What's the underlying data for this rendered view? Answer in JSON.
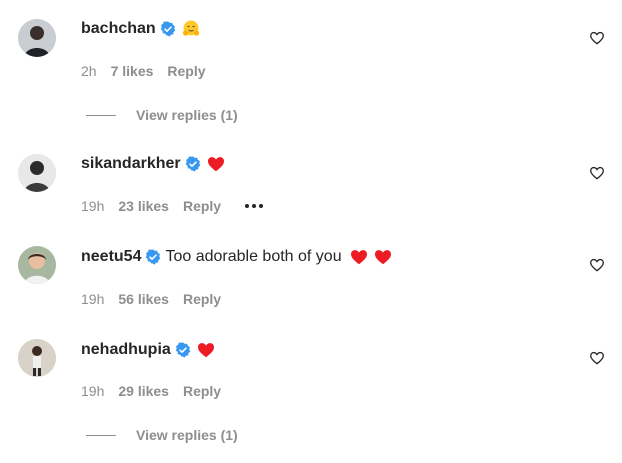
{
  "comments": [
    {
      "username": "bachchan",
      "text": "",
      "emoji": "hugging-face-emoji",
      "time": "2h",
      "likes": "7 likes",
      "reply": "Reply",
      "has_more": false,
      "view_replies": "View replies (1)"
    },
    {
      "username": "sikandarkher",
      "text": "",
      "emoji": "red-heart-emoji",
      "time": "19h",
      "likes": "23 likes",
      "reply": "Reply",
      "has_more": true,
      "view_replies": ""
    },
    {
      "username": "neetu54",
      "text": "Too adorable both of you",
      "emoji": "two-red-hearts-emoji",
      "time": "19h",
      "likes": "56 likes",
      "reply": "Reply",
      "has_more": false,
      "view_replies": ""
    },
    {
      "username": "nehadhupia",
      "text": "",
      "emoji": "red-heart-emoji",
      "time": "19h",
      "likes": "29 likes",
      "reply": "Reply",
      "has_more": false,
      "view_replies": "View replies (1)"
    }
  ],
  "colors": {
    "verified": "#3897f0",
    "heart": "#ed4956",
    "muted": "#8e8e8e",
    "text": "#262626"
  }
}
